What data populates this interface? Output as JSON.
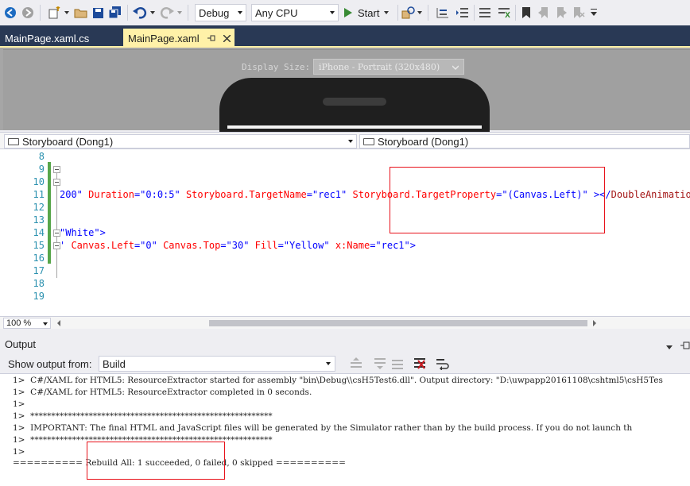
{
  "toolbar": {
    "config_value": "Debug",
    "platform_value": "Any CPU",
    "start_label": "Start",
    "icons": [
      "back-icon",
      "forward-icon",
      "new-project-icon",
      "open-icon",
      "save-icon",
      "save-all-icon",
      "undo-icon",
      "redo-icon",
      "play-icon",
      "find-icon",
      "bookmark-icon"
    ]
  },
  "tabs": [
    {
      "label": "MainPage.xaml.cs",
      "active": false
    },
    {
      "label": "MainPage.xaml",
      "active": true
    }
  ],
  "designer": {
    "display_size_label": "Display Size:",
    "display_size_value": "iPhone - Portrait (320x480)"
  },
  "navbar": {
    "left_value": "Storyboard (Dong1)",
    "right_value": "Storyboard (Dong1)"
  },
  "editor": {
    "line_numbers": [
      "8",
      "9",
      "10",
      "11",
      "12",
      "13",
      "14",
      "15",
      "16",
      "17",
      "18",
      "19"
    ],
    "line11": {
      "p1": "200\"",
      "a1": " Duration",
      "v1": "=\"0:0:5\"",
      "a2": " Storyboard.TargetName",
      "v2": "=\"rec1\"",
      "a3": " Storyboard.TargetProperty",
      "v3": "=\"(Canvas.Left)\"",
      "t1": " ></",
      "t2": "DoubleAnimation",
      "t3": ">"
    },
    "line14": {
      "v1": "\"White\"",
      "p1": ">"
    },
    "line15": {
      "p0": "'",
      "a1": " Canvas.Left",
      "v1": "=\"0\"",
      "a2": " Canvas.Top",
      "v2": "=\"30\"",
      "a3": " Fill",
      "v3": "=\"Yellow\"",
      "a4": " x:Name",
      "v4": "=\"rec1\"",
      "p1": ">"
    },
    "zoom": "100 %"
  },
  "output": {
    "title": "Output",
    "show_from_label": "Show output from:",
    "show_from_value": "Build",
    "lines": [
      "1>  C#/XAML for HTML5: ResourceExtractor started for assembly \"bin\\Debug\\\\csH5Test6.dll\". Output directory: \"D:\\uwpapp20161108\\cshtml5\\csH5Tes",
      "1>  C#/XAML for HTML5: ResourceExtractor completed in 0 seconds.",
      "1>",
      "1>  **********************************************************",
      "1>  IMPORTANT: The final HTML and JavaScript files will be generated by the Simulator rather than by the build process. If you do not launch th",
      "1>  **********************************************************",
      "1>",
      "========== Rebuild All: 1 succeeded, 0 failed, 0 skipped =========="
    ]
  },
  "colors": {
    "tab_bar": "#293955",
    "active_tab": "#fff1a8",
    "attr": "#ff0000",
    "value": "#0000ff",
    "tag": "#a31515",
    "line_number": "#2b91af",
    "change_bar": "#57a64a",
    "highlight_box": "#e8111a"
  }
}
